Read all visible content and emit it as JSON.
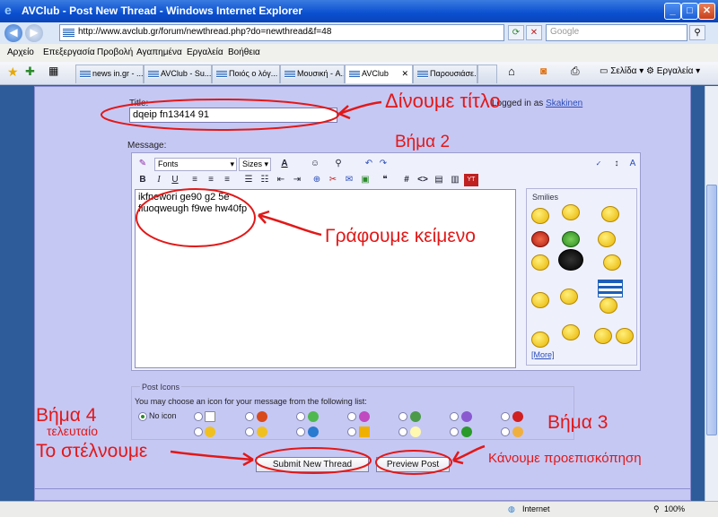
{
  "window": {
    "title": "AVClub - Post New Thread - Windows Internet Explorer"
  },
  "address": {
    "url": "http://www.avclub.gr/forum/newthread.php?do=newthread&f=48",
    "search_placeholder": "Google"
  },
  "menu": [
    "Αρχείο",
    "Επεξεργασία",
    "Προβολή",
    "Αγαπημένα",
    "Εργαλεία",
    "Βοήθεια"
  ],
  "tabs": [
    "news in.gr - ...",
    "AVClub - Su...",
    "Ποιός ο λόγ...",
    "Μουσική - A...",
    "AVClub",
    "Παρουσιάσε..."
  ],
  "command_bar": {
    "page": "Σελίδα",
    "tools": "Εργαλεία"
  },
  "form": {
    "title_label": "Title:",
    "title_value": "dqeip fn13414 91",
    "logged_in_prefix": "Logged in as",
    "username": "Skakinen",
    "message_label": "Message:",
    "font_select": "Fonts",
    "size_select": "Sizes",
    "message_text": "ikfnewori ge90 g2 5e\nfiuoqweugh f9we hw40fp",
    "smilies_label": "Smilies",
    "more_link": "[More]",
    "post_icons_label": "Post Icons",
    "post_icons_hint": "You may choose an icon for your message from the following list:",
    "no_icon_label": "No icon",
    "submit_button": "Submit New Thread",
    "preview_button": "Preview Post"
  },
  "annotations": {
    "title_note": "Δίνουμε τίτλο",
    "step2": "Βήμα 2",
    "write_text": "Γράφουμε κείμενο",
    "step3": "Βήμα 3",
    "preview_note": "Κάνουμε προεπισκόπηση",
    "step4": "Βήμα 4",
    "step4_sub": "τελευταίο",
    "send_note": "Το στέλνουμε"
  },
  "status": {
    "zone": "Internet",
    "zoom": "100%"
  }
}
